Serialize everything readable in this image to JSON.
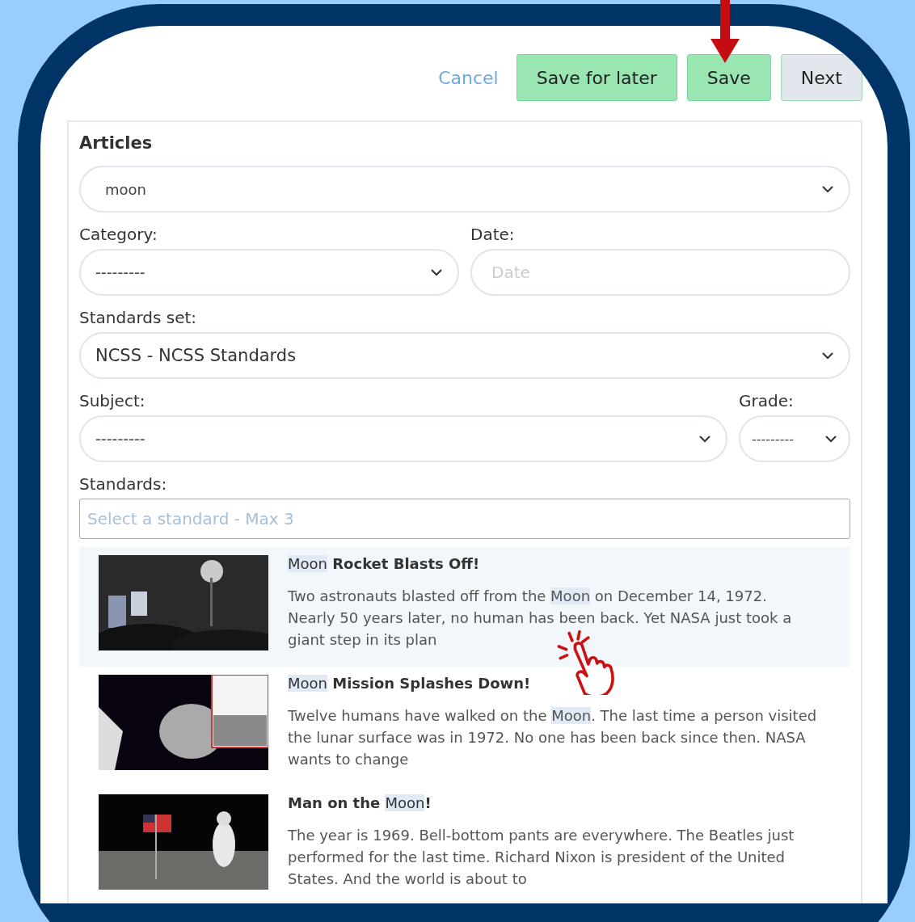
{
  "actions": {
    "cancel": "Cancel",
    "save_for_later": "Save for later",
    "save": "Save",
    "next": "Next"
  },
  "form": {
    "title": "Articles",
    "search": {
      "value": "moon"
    },
    "category": {
      "label": "Category:",
      "value": "---------"
    },
    "date": {
      "label": "Date:",
      "placeholder": "Date"
    },
    "standards_set": {
      "label": "Standards set:",
      "value": "NCSS - NCSS Standards"
    },
    "subject": {
      "label": "Subject:",
      "value": "---------"
    },
    "grade": {
      "label": "Grade:",
      "value": "---------"
    },
    "standards": {
      "label": "Standards:",
      "placeholder": "Select a standard - Max 3"
    }
  },
  "articles": [
    {
      "selected": true,
      "title": [
        {
          "text": "Moon",
          "highlighted": true
        },
        {
          "text": " Rocket Blasts Off!",
          "highlighted": false
        }
      ],
      "summary": [
        {
          "text": "Two astronauts blasted off from the ",
          "highlighted": false
        },
        {
          "text": "Moon",
          "highlighted": true
        },
        {
          "text": " on December 14, 1972. Nearly 50 years later, no human has been back. Yet NASA just took a giant step in its plan",
          "highlighted": false
        }
      ]
    },
    {
      "selected": false,
      "title": [
        {
          "text": "Moon",
          "highlighted": true
        },
        {
          "text": " Mission Splashes Down!",
          "highlighted": false
        }
      ],
      "summary": [
        {
          "text": "Twelve humans have walked on the ",
          "highlighted": false
        },
        {
          "text": "Moon",
          "highlighted": true
        },
        {
          "text": ". The last time a person visited the lunar surface was in 1972. No one has been back since then. NASA wants to change",
          "highlighted": false
        }
      ]
    },
    {
      "selected": false,
      "title": [
        {
          "text": "Man on the ",
          "highlighted": false
        },
        {
          "text": "Moon",
          "highlighted": true
        },
        {
          "text": "!",
          "highlighted": false
        }
      ],
      "summary": [
        {
          "text": "The year is 1969. Bell-bottom pants are everywhere. The Beatles just performed for the last time. Richard Nixon is president of the United States. And the world is about to",
          "highlighted": false
        }
      ]
    }
  ]
}
